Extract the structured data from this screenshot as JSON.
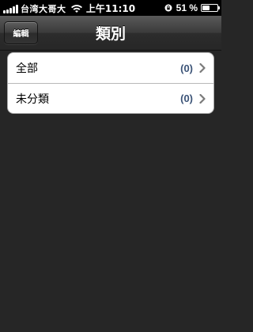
{
  "status_bar": {
    "carrier": "台湾大哥大",
    "time": "上午11:10",
    "battery_percent": "51 %",
    "battery_level": 0.51,
    "icons": [
      "signal-icon",
      "wifi-icon",
      "rotation-lock-icon",
      "battery-icon"
    ]
  },
  "nav_bar": {
    "title": "類別",
    "edit_label": "編輯"
  },
  "categories": [
    {
      "label": "全部",
      "count": "(0)"
    },
    {
      "label": "未分類",
      "count": "(0)"
    }
  ],
  "colors": {
    "background": "#262626",
    "count_text": "#3b5377"
  }
}
